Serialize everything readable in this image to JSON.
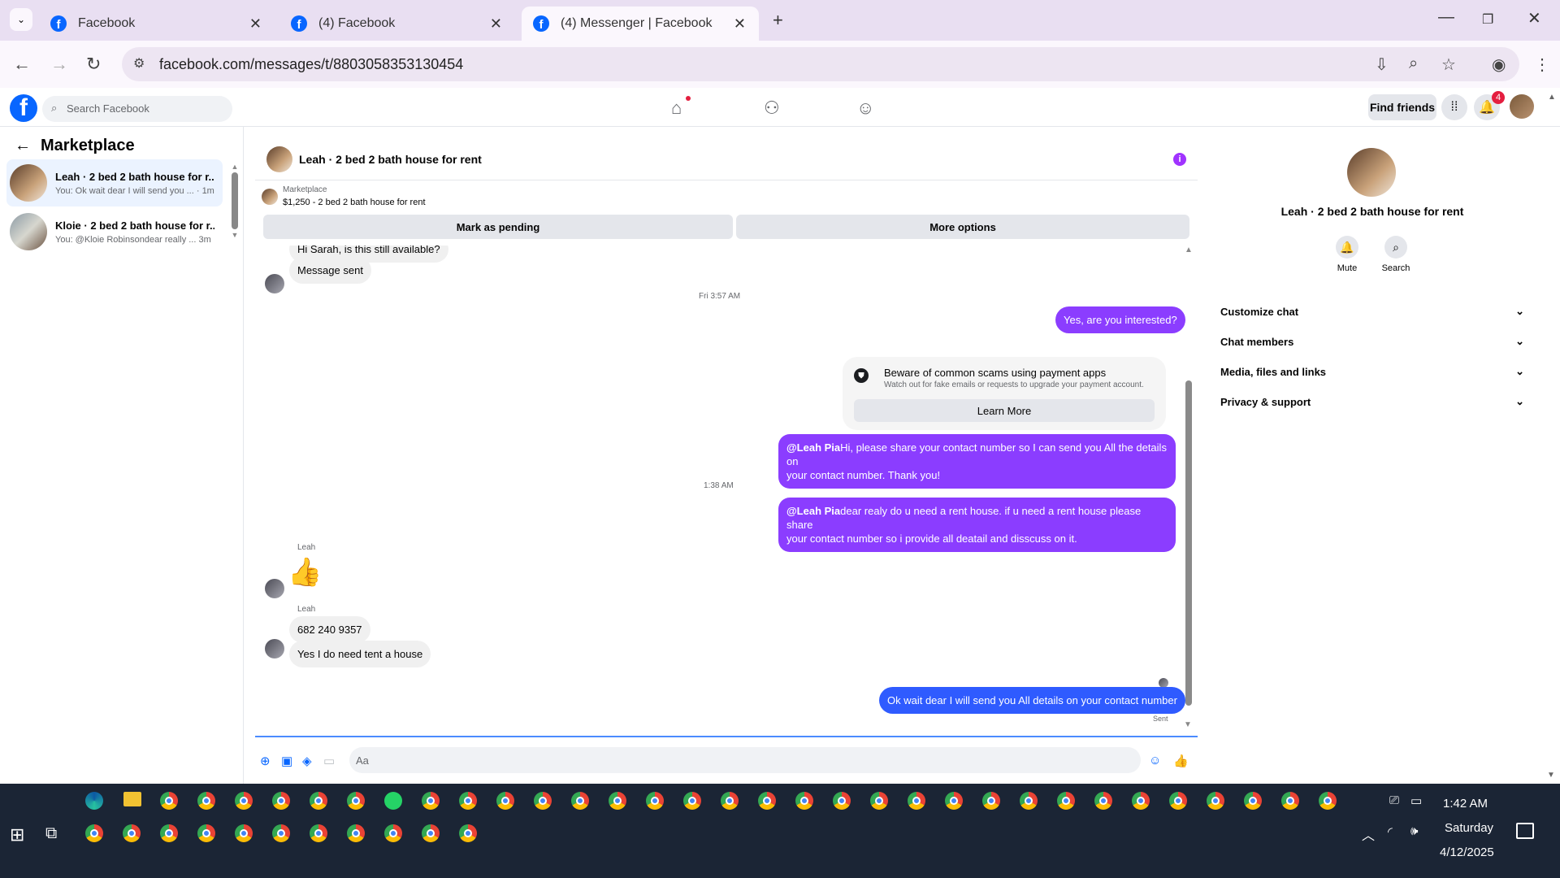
{
  "browser": {
    "tabs": [
      {
        "label": "Facebook"
      },
      {
        "label": "(4) Facebook"
      },
      {
        "label": "(4) Messenger | Facebook"
      }
    ],
    "url": "facebook.com/messages/t/8803058353130454"
  },
  "fb": {
    "search_placeholder": "Search Facebook",
    "find_friends": "Find friends",
    "notif_count": "4"
  },
  "sidebar": {
    "title": "Marketplace",
    "conversations": [
      {
        "title": "Leah · 2 bed 2 bath house for r...",
        "preview": "You: Ok wait dear I will send you ... · 1m"
      },
      {
        "title": "Kloie · 2 bed 2 bath house for r...",
        "preview": "You: @Kloie Robinsondear really ...   3m"
      }
    ]
  },
  "chat": {
    "title": "Leah · 2 bed 2 bath house for rent",
    "listing_label": "Marketplace",
    "listing_detail": "$1,250 - 2 bed 2 bath house for rent",
    "mark_pending": "Mark as pending",
    "more_options": "More options",
    "messages": {
      "m0": "Hi Sarah, is this still available?",
      "m1": "Message sent",
      "ts1": "Fri 3:57 AM",
      "m2": "Yes, are you interested?",
      "scam_title": "Beware of common scams using payment apps",
      "scam_sub": "Watch out for fake emails or requests to upgrade your payment account.",
      "learn_more": "Learn More",
      "m3_mention": "@Leah Pia",
      "m3_line1": "Hi, please share your contact number so I can send you All the details on",
      "m3_line2": "your contact number. Thank you!",
      "ts2": "1:38 AM",
      "m4_mention": "@Leah Pia",
      "m4_line1": "dear realy do u need a rent house. if u need a rent house please share",
      "m4_line2": "your contact number so i provide all deatail and disscuss on it.",
      "sender1": "Leah",
      "sender2": "Leah",
      "m5": "682 240 9357",
      "m6": "Yes I do need tent a house",
      "m7": "Ok wait dear I will send you All details on your contact number",
      "status": "Sent"
    },
    "composer_placeholder": "Aa"
  },
  "right_panel": {
    "name": "Leah · 2 bed 2 bath house for rent",
    "mute": "Mute",
    "search": "Search",
    "sections": [
      "Customize chat",
      "Chat members",
      "Media, files and links",
      "Privacy & support"
    ]
  },
  "taskbar": {
    "time": "1:42 AM",
    "day": "Saturday",
    "date": "4/12/2025"
  },
  "colors": {
    "messenger_purple": "#8b3dff",
    "messenger_blue": "#2f5bff",
    "fb_blue": "#0866ff"
  }
}
